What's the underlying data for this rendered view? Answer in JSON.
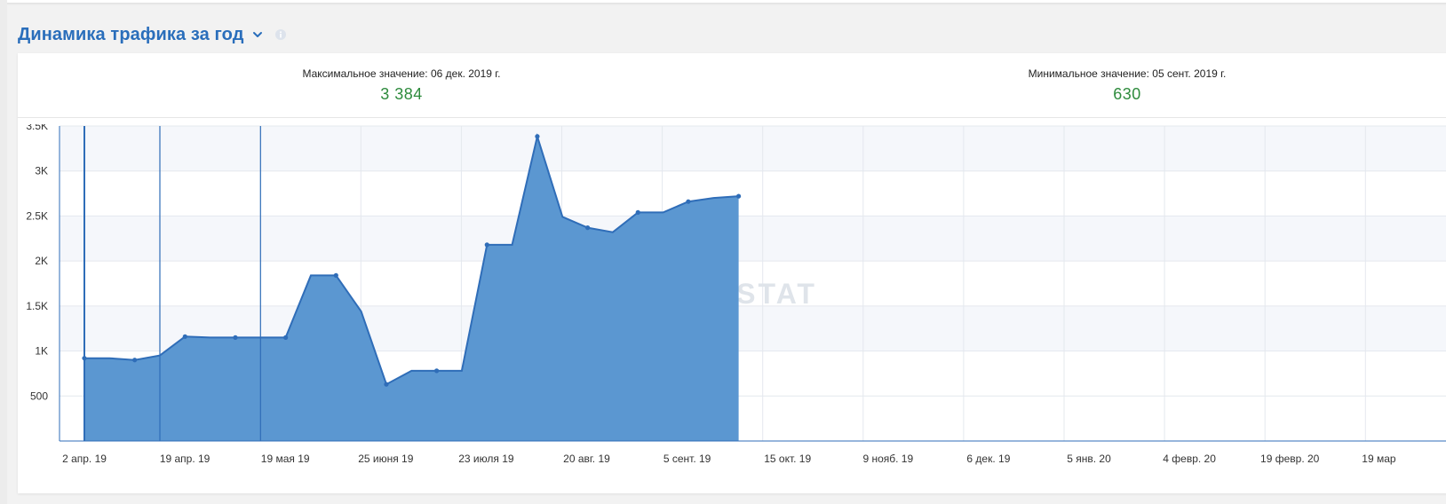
{
  "header": {
    "title": "Динамика трафика за год",
    "chevron_icon": "chevron-down-icon",
    "info_icon": "info-icon"
  },
  "stats": {
    "max_label": "Максимальное значение: 06 дек. 2019 г.",
    "max_value": "3 384",
    "min_label": "Минимальное значение: 05 сент. 2019 г.",
    "min_value": "630"
  },
  "watermark": "SERPSTAT",
  "colors": {
    "accent": "#2a6ebb",
    "line": "#2f6db8",
    "area": "#5b97d1",
    "value_green": "#2e8b3d",
    "band": "#f5f7fb"
  },
  "chart_data": {
    "type": "area",
    "title": "",
    "xlabel": "",
    "ylabel": "",
    "ylim": [
      0,
      3500
    ],
    "y_ticks": [
      "500",
      "1K",
      "1.5K",
      "2K",
      "2.5K",
      "3K",
      "3.5K"
    ],
    "y_tick_values": [
      500,
      1000,
      1500,
      2000,
      2500,
      3000,
      3500
    ],
    "x_tick_labels": [
      "2 апр. 19",
      "19 апр. 19",
      "19 мая 19",
      "25 июня 19",
      "23 июля 19",
      "20 авг. 19",
      "5 сент. 19",
      "15 окт. 19",
      "9 нояб. 19",
      "6 дек. 19",
      "5 янв. 20",
      "4 февр. 20",
      "19 февр. 20",
      "19 мар"
    ],
    "grid": true,
    "series": [
      {
        "values": [
          920,
          920,
          900,
          950,
          1160,
          1150,
          1150,
          1150,
          1150,
          1840,
          1840,
          1440,
          630,
          780,
          780,
          780,
          2180,
          2180,
          3384,
          2490,
          2370,
          2320,
          2540,
          2540,
          2660,
          2700,
          2720
        ],
        "markers": [
          0,
          2,
          4,
          6,
          8,
          10,
          12,
          14,
          16,
          18,
          20,
          22,
          24,
          26
        ]
      }
    ],
    "annotation_lines": [
      0,
      3,
      7
    ]
  }
}
